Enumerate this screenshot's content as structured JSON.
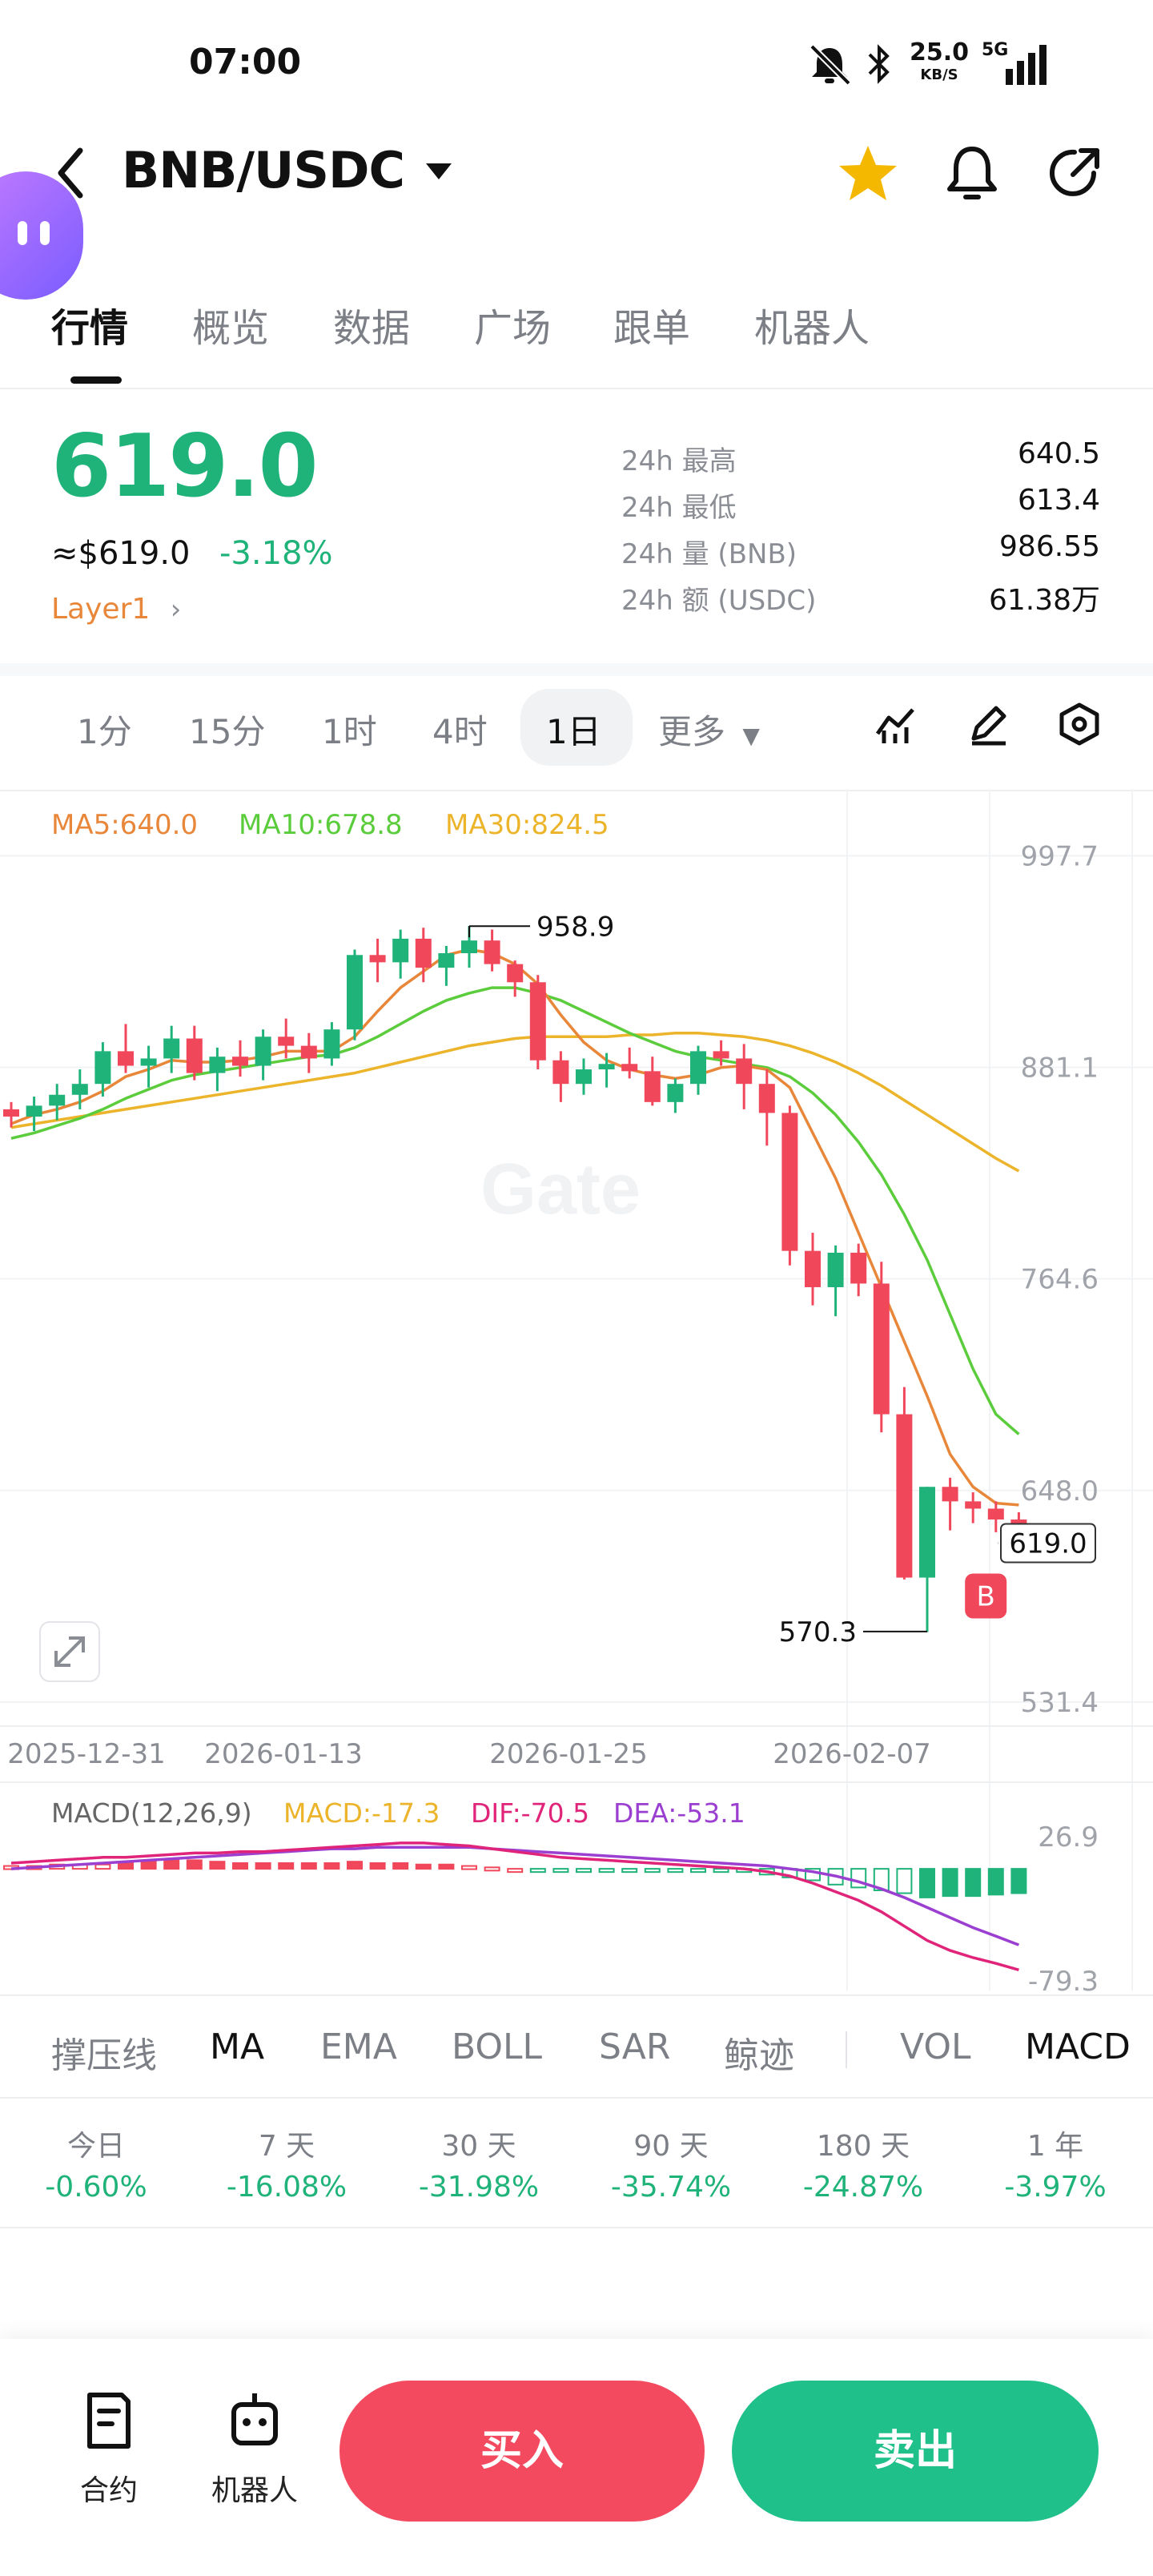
{
  "status_bar": {
    "time": "07:00",
    "net_speed": "25.0",
    "net_unit": "KB/S",
    "network": "5G"
  },
  "header": {
    "pair": "BNB/USDC"
  },
  "tabs": [
    "行情",
    "概览",
    "数据",
    "广场",
    "跟单",
    "机器人"
  ],
  "price": {
    "last": "619.0",
    "usd": "≈$619.0",
    "change": "-3.18%",
    "sector": "Layer1"
  },
  "stats": [
    {
      "label": "24h  最高",
      "value": "640.5"
    },
    {
      "label": "24h  最低",
      "value": "613.4"
    },
    {
      "label": "24h  量 (BNB)",
      "value": "986.55"
    },
    {
      "label": "24h  额 (USDC)",
      "value": "61.38万"
    }
  ],
  "timeframes": [
    "1分",
    "15分",
    "1时",
    "4时",
    "1日",
    "更多"
  ],
  "active_timeframe": "1日",
  "chart_data": {
    "type": "candlestick",
    "ma_labels": {
      "ma5": "MA5:640.0",
      "ma10": "MA10:678.8",
      "ma30": "MA30:824.5"
    },
    "ylim": [
      531.4,
      1008
    ],
    "y_ticks": [
      "997.7",
      "881.1",
      "764.6",
      "648.0",
      "531.4"
    ],
    "x_ticks": [
      "2025-12-31",
      "2026-01-13",
      "2026-01-25",
      "2026-02-07"
    ],
    "annotations": {
      "high": "958.9",
      "low": "570.3",
      "current": "619.0",
      "marker": "B"
    },
    "candles": [
      [
        858,
        862,
        848,
        854
      ],
      [
        854,
        865,
        846,
        860
      ],
      [
        860,
        872,
        852,
        866
      ],
      [
        866,
        880,
        858,
        872
      ],
      [
        872,
        895,
        865,
        890
      ],
      [
        890,
        905,
        878,
        882
      ],
      [
        882,
        893,
        870,
        886
      ],
      [
        886,
        904,
        878,
        897
      ],
      [
        897,
        904,
        874,
        878
      ],
      [
        878,
        892,
        868,
        887
      ],
      [
        887,
        896,
        876,
        882
      ],
      [
        882,
        902,
        874,
        898
      ],
      [
        898,
        908,
        886,
        893
      ],
      [
        893,
        900,
        878,
        886
      ],
      [
        886,
        906,
        882,
        902
      ],
      [
        902,
        946,
        896,
        943
      ],
      [
        943,
        952,
        928,
        939
      ],
      [
        939,
        957,
        930,
        952
      ],
      [
        952,
        958,
        928,
        936
      ],
      [
        936,
        948,
        926,
        944
      ],
      [
        944,
        959,
        936,
        951
      ],
      [
        951,
        957,
        934,
        938
      ],
      [
        938,
        940,
        920,
        928
      ],
      [
        928,
        932,
        880,
        885
      ],
      [
        885,
        890,
        862,
        872
      ],
      [
        872,
        886,
        866,
        880
      ],
      [
        880,
        889,
        870,
        883
      ],
      [
        883,
        892,
        875,
        879
      ],
      [
        879,
        887,
        860,
        862
      ],
      [
        862,
        875,
        856,
        872
      ],
      [
        872,
        893,
        866,
        890
      ],
      [
        890,
        896,
        882,
        886
      ],
      [
        886,
        894,
        858,
        872
      ],
      [
        872,
        880,
        838,
        856
      ],
      [
        856,
        860,
        772,
        780
      ],
      [
        780,
        790,
        750,
        760
      ],
      [
        760,
        783,
        744,
        779
      ],
      [
        779,
        784,
        755,
        762
      ],
      [
        762,
        774,
        680,
        690
      ],
      [
        690,
        705,
        599,
        600
      ],
      [
        600,
        650,
        570,
        650
      ],
      [
        650,
        655,
        626,
        642
      ],
      [
        642,
        647,
        630,
        638
      ],
      [
        638,
        642,
        625,
        632
      ],
      [
        632,
        636,
        620,
        619
      ]
    ],
    "ma5": [
      850,
      855,
      858,
      862,
      868,
      876,
      880,
      885,
      884,
      884,
      885,
      887,
      890,
      890,
      890,
      898,
      912,
      925,
      934,
      943,
      946,
      944,
      938,
      927,
      910,
      895,
      885,
      880,
      877,
      875,
      877,
      881,
      882,
      880,
      870,
      845,
      820,
      790,
      760,
      730,
      700,
      668,
      650,
      641,
      640
    ],
    "ma10": [
      842,
      845,
      849,
      853,
      858,
      864,
      869,
      874,
      877,
      879,
      881,
      883,
      885,
      887,
      888,
      892,
      898,
      905,
      912,
      918,
      922,
      925,
      925,
      922,
      918,
      912,
      906,
      900,
      895,
      890,
      887,
      885,
      883,
      881,
      876,
      867,
      855,
      840,
      822,
      800,
      775,
      745,
      715,
      690,
      679
    ],
    "ma30": [
      848,
      850,
      852,
      854,
      856,
      858,
      860,
      862,
      864,
      866,
      868,
      870,
      872,
      874,
      876,
      878,
      881,
      884,
      887,
      890,
      893,
      895,
      897,
      898,
      898,
      898,
      898,
      899,
      899,
      900,
      900,
      899,
      898,
      896,
      893,
      889,
      884,
      878,
      871,
      863,
      855,
      847,
      839,
      831,
      824
    ],
    "macd_labels": {
      "title": "MACD(12,26,9)",
      "macd": "MACD:-17.3",
      "dif": "DIF:-70.5",
      "dea": "DEA:-53.1",
      "y_top": "26.9",
      "y_bottom": "-79.3"
    },
    "macd_ylim": [
      -79.3,
      26.9
    ],
    "macd_hist": [
      2,
      2,
      3,
      3,
      3,
      4,
      5,
      6,
      6,
      5,
      4,
      4,
      4,
      4,
      4,
      5,
      4,
      4,
      3,
      3,
      2,
      1,
      0,
      -1,
      -2,
      -2,
      -2,
      -2,
      -2,
      -1,
      -1,
      -1,
      -2,
      -4,
      -6,
      -8,
      -11,
      -13,
      -15,
      -17,
      -20,
      -19,
      -19,
      -18,
      -17
    ],
    "dif": [
      4,
      5,
      6,
      7,
      8,
      8,
      9,
      10,
      11,
      11,
      12,
      12,
      13,
      14,
      15,
      16,
      17,
      18,
      18,
      17,
      16,
      14,
      12,
      10,
      8,
      7,
      6,
      5,
      4,
      3,
      2,
      1,
      0,
      -2,
      -5,
      -10,
      -16,
      -22,
      -30,
      -40,
      -50,
      -57,
      -62,
      -66,
      -70.5
    ],
    "dea": [
      0,
      1,
      2,
      3,
      4,
      5,
      6,
      7,
      8,
      9,
      10,
      11,
      12,
      13,
      14,
      14,
      15,
      15,
      15,
      15,
      15,
      14,
      13,
      12,
      11,
      10,
      9,
      8,
      7,
      6,
      5,
      4,
      3,
      2,
      0,
      -2,
      -5,
      -9,
      -14,
      -20,
      -27,
      -34,
      -41,
      -47,
      -53.1
    ]
  },
  "indicators": [
    "撑压线",
    "MA",
    "EMA",
    "BOLL",
    "SAR",
    "鲸迹",
    "VOL",
    "MACD"
  ],
  "active_indicators": [
    "MA",
    "MACD"
  ],
  "periods": [
    {
      "label": "今日",
      "value": "-0.60%"
    },
    {
      "label": "7 天",
      "value": "-16.08%"
    },
    {
      "label": "30 天",
      "value": "-31.98%"
    },
    {
      "label": "90 天",
      "value": "-35.74%"
    },
    {
      "label": "180 天",
      "value": "-24.87%"
    },
    {
      "label": "1 年",
      "value": "-3.97%"
    }
  ],
  "bottom": {
    "contract": "合约",
    "bot": "机器人",
    "buy": "买入",
    "sell": "卖出"
  },
  "colors": {
    "up": "#1fb37a",
    "down": "#f0475b",
    "ma5": "#e8873a",
    "ma10": "#5bcc3c",
    "ma30": "#ecb42a",
    "dif": "#e0247a",
    "dea": "#9b3fd1"
  }
}
